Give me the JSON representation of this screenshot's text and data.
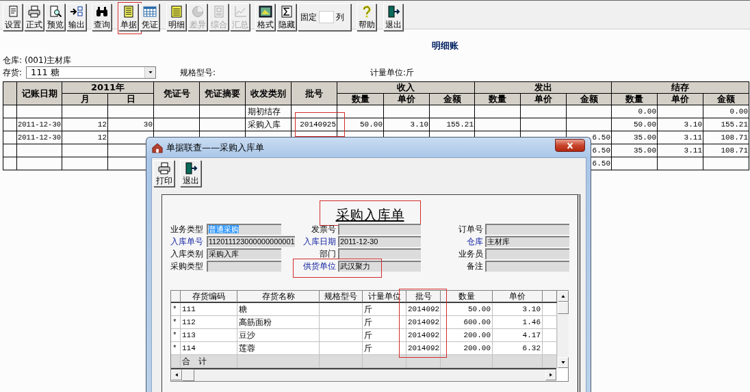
{
  "toolbar": {
    "items": [
      {
        "kind": "button",
        "label": "设置",
        "disabled": false,
        "highlighted": false
      },
      {
        "kind": "button",
        "label": "正式",
        "disabled": false,
        "highlighted": false
      },
      {
        "kind": "button",
        "label": "预览",
        "disabled": false,
        "highlighted": false
      },
      {
        "kind": "button",
        "label": "输出",
        "disabled": false,
        "highlighted": false
      },
      {
        "kind": "button",
        "label": "查询",
        "disabled": false,
        "highlighted": false
      },
      {
        "kind": "button",
        "label": "单据",
        "disabled": false,
        "highlighted": true
      },
      {
        "kind": "button",
        "label": "凭证",
        "disabled": false,
        "highlighted": false
      },
      {
        "kind": "button",
        "label": "明细",
        "disabled": false,
        "highlighted": false
      },
      {
        "kind": "button",
        "label": "差异",
        "disabled": true,
        "highlighted": false
      },
      {
        "kind": "button",
        "label": "综合",
        "disabled": true,
        "highlighted": false
      },
      {
        "kind": "button",
        "label": "汇总",
        "disabled": true,
        "highlighted": false
      },
      {
        "kind": "button",
        "label": "格式",
        "disabled": false,
        "highlighted": false
      },
      {
        "kind": "button",
        "label": "隐藏",
        "disabled": false,
        "highlighted": false
      },
      {
        "kind": "fixed",
        "label": "固定",
        "suffix": "列"
      },
      {
        "kind": "button",
        "label": "帮助",
        "disabled": false,
        "highlighted": false
      },
      {
        "kind": "button",
        "label": "退出",
        "disabled": false,
        "highlighted": false
      }
    ]
  },
  "report": {
    "title": "明细账",
    "warehouse": {
      "label": "仓库:",
      "value": "(001)主材库"
    },
    "item": {
      "label": "存货:",
      "value": "111 糖"
    },
    "spec": {
      "label": "规格型号:"
    },
    "unit": {
      "label": "计量单位:",
      "value": "斤"
    }
  },
  "table": {
    "columns": [
      {
        "kind": "single",
        "label": "记账日期"
      },
      {
        "kind": "group_start",
        "group": "2011年",
        "label": "月"
      },
      {
        "kind": "grouped",
        "label": "日"
      },
      {
        "kind": "single",
        "label": "凭证号"
      },
      {
        "kind": "single",
        "label": "凭证摘要"
      },
      {
        "kind": "single",
        "label": "收发类别"
      },
      {
        "kind": "single",
        "label": "批号"
      },
      {
        "kind": "group_start",
        "group": "收入",
        "label": "数量"
      },
      {
        "kind": "grouped",
        "label": "单价"
      },
      {
        "kind": "grouped",
        "label": "金额"
      },
      {
        "kind": "group_start",
        "group": "发出",
        "label": "数量"
      },
      {
        "kind": "grouped",
        "label": "单价"
      },
      {
        "kind": "grouped",
        "label": "金额"
      },
      {
        "kind": "group_start",
        "group": "结存",
        "label": "数量"
      },
      {
        "kind": "grouped",
        "label": "单价"
      },
      {
        "kind": "grouped",
        "label": "金额"
      }
    ],
    "rows": [
      {
        "batch_highlighted": false,
        "cells": [
          null,
          null,
          null,
          null,
          null,
          "期初结存",
          null,
          null,
          null,
          null,
          null,
          null,
          null,
          "0.00",
          null,
          "0.00"
        ]
      },
      {
        "batch_highlighted": true,
        "cells": [
          "2011-12-30",
          "12",
          "30",
          null,
          null,
          "采购入库",
          "20140925",
          "50.00",
          "3.10",
          "155.21",
          null,
          null,
          null,
          "50.00",
          "3.10",
          "155.21"
        ]
      },
      {
        "cells": [
          "2011-12-30",
          "12",
          null,
          null,
          null,
          null,
          null,
          null,
          null,
          null,
          null,
          null,
          "6.50",
          "35.00",
          "3.11",
          "108.71"
        ]
      },
      {
        "cells": [
          null,
          null,
          null,
          null,
          null,
          null,
          null,
          null,
          null,
          null,
          null,
          null,
          "6.50",
          "35.00",
          "3.11",
          "108.71"
        ]
      },
      {
        "cells": [
          null,
          null,
          null,
          null,
          null,
          null,
          null,
          null,
          null,
          null,
          null,
          null,
          "6.50",
          null,
          null,
          null
        ]
      }
    ]
  },
  "dialog": {
    "title": "单据联查——采购入库单",
    "toolbar": [
      {
        "label": "打印"
      },
      {
        "label": "退出"
      }
    ],
    "form": {
      "title": "采购入库单",
      "title_highlighted": true,
      "fields": [
        {
          "label": "业务类型",
          "value": "普通采购",
          "required": false,
          "selected": true,
          "highlighted": false
        },
        {
          "label": "发票号",
          "required": false,
          "selected": false,
          "highlighted": false
        },
        {
          "label": "订单号",
          "required": false,
          "selected": false,
          "highlighted": false
        },
        {
          "label": "入库单号",
          "value": "112011123000000000001",
          "required": true,
          "selected": false,
          "highlighted": false
        },
        {
          "label": "入库日期",
          "value": "2011-12-30",
          "required": true,
          "selected": false,
          "highlighted": false
        },
        {
          "label": "仓库",
          "value": "主材库",
          "required": true,
          "selected": false,
          "highlighted": false
        },
        {
          "label": "入库类别",
          "value": "采购入库",
          "required": false,
          "selected": false,
          "highlighted": false
        },
        {
          "label": "部门",
          "required": false,
          "selected": false,
          "highlighted": false
        },
        {
          "label": "业务员",
          "required": false,
          "selected": false,
          "highlighted": false
        },
        {
          "label": "采购类型",
          "required": false,
          "selected": false,
          "highlighted": false
        },
        {
          "label": "供货单位",
          "value": "武汉聚力",
          "required": true,
          "selected": false,
          "highlighted": true
        },
        {
          "label": "备注",
          "required": false,
          "selected": false,
          "highlighted": false
        }
      ]
    },
    "grid": {
      "columns": [
        {
          "label": "存货编码",
          "highlighted": false
        },
        {
          "label": "存货名称",
          "highlighted": false
        },
        {
          "label": "规格型号",
          "highlighted": false
        },
        {
          "label": "计量单位",
          "highlighted": false
        },
        {
          "label": "批号",
          "highlighted": true
        },
        {
          "label": "数量",
          "highlighted": false
        },
        {
          "label": "单价",
          "highlighted": false
        }
      ],
      "rows": [
        {
          "marker": "*",
          "cells": [
            "111",
            "糖",
            null,
            "斤",
            "2014092",
            "50.00",
            "3.10"
          ]
        },
        {
          "marker": "*",
          "cells": [
            "112",
            "高筋面粉",
            null,
            "斤",
            "2014092",
            "600.00",
            "1.46"
          ]
        },
        {
          "marker": "*",
          "cells": [
            "113",
            "豆沙",
            null,
            "斤",
            "2014092",
            "200.00",
            "4.17"
          ]
        },
        {
          "marker": "*",
          "cells": [
            "114",
            "莲蓉",
            null,
            "斤",
            "2014092",
            "200.00",
            "6.32"
          ]
        }
      ],
      "total": {
        "label": "合 计"
      }
    }
  }
}
